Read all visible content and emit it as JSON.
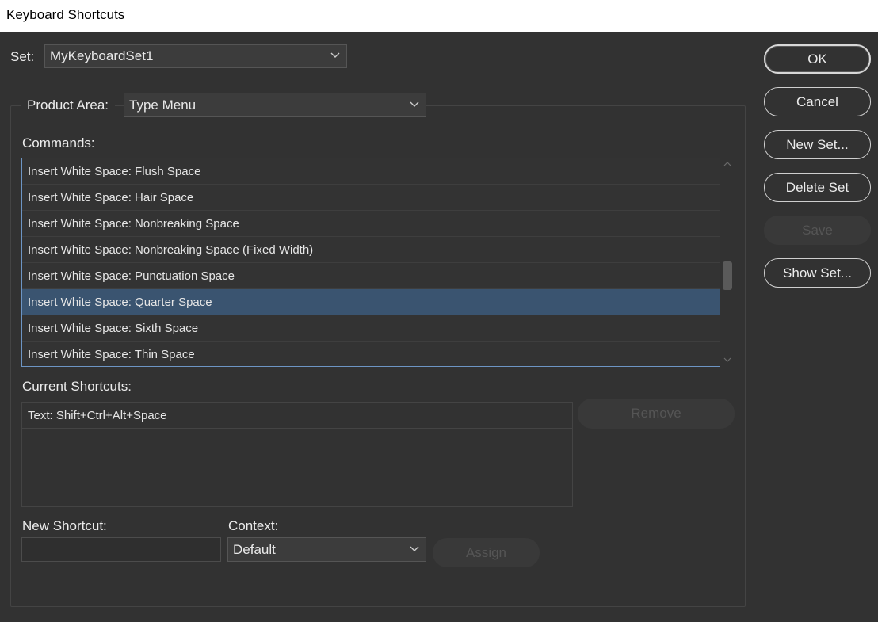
{
  "window": {
    "title": "Keyboard Shortcuts"
  },
  "set": {
    "label": "Set:",
    "value": "MyKeyboardSet1"
  },
  "product_area": {
    "label": "Product Area:",
    "value": "Type Menu"
  },
  "commands": {
    "label": "Commands:",
    "items": [
      "Insert White Space: Flush Space",
      "Insert White Space: Hair Space",
      "Insert White Space: Nonbreaking Space",
      "Insert White Space: Nonbreaking Space (Fixed Width)",
      "Insert White Space: Punctuation Space",
      "Insert White Space: Quarter Space",
      "Insert White Space: Sixth Space",
      "Insert White Space: Thin Space"
    ],
    "selected_index": 5
  },
  "current_shortcuts": {
    "label": "Current Shortcuts:",
    "items": [
      "Text: Shift+Ctrl+Alt+Space"
    ],
    "remove_label": "Remove"
  },
  "new_shortcut": {
    "label": "New Shortcut:",
    "value": ""
  },
  "context": {
    "label": "Context:",
    "value": "Default"
  },
  "assign_label": "Assign",
  "buttons": {
    "ok": "OK",
    "cancel": "Cancel",
    "new_set": "New Set...",
    "delete_set": "Delete Set",
    "save": "Save",
    "show_set": "Show Set..."
  },
  "colors": {
    "background": "#323232",
    "selection": "#3a5470",
    "list_border": "#6d95c4"
  }
}
